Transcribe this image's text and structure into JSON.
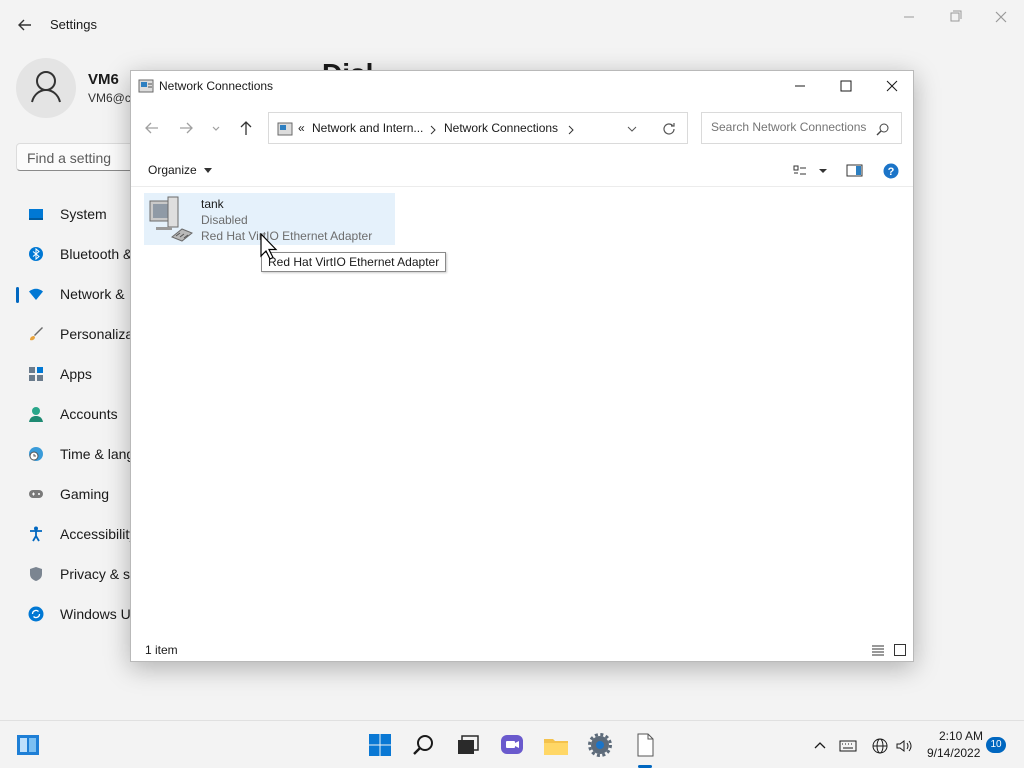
{
  "settings": {
    "title": "Settings",
    "user": {
      "name": "VM6",
      "email": "VM6@c"
    },
    "search_placeholder": "Find a setting",
    "page_heading_partial": "Disl",
    "nav": [
      {
        "label": "System",
        "icon": "monitor-icon"
      },
      {
        "label": "Bluetooth &",
        "icon": "bluetooth-icon"
      },
      {
        "label": "Network &",
        "icon": "wifi-icon",
        "selected": true
      },
      {
        "label": "Personaliza",
        "icon": "brush-icon"
      },
      {
        "label": "Apps",
        "icon": "apps-icon"
      },
      {
        "label": "Accounts",
        "icon": "person-icon"
      },
      {
        "label": "Time & lang",
        "icon": "clock-globe-icon"
      },
      {
        "label": "Gaming",
        "icon": "gamepad-icon"
      },
      {
        "label": "Accessibility",
        "icon": "accessibility-icon"
      },
      {
        "label": "Privacy & se",
        "icon": "shield-icon"
      },
      {
        "label": "Windows U",
        "icon": "sync-icon"
      }
    ]
  },
  "explorer": {
    "title": "Network Connections",
    "address": {
      "overflow": "«",
      "crumbs": [
        "Network and Intern...",
        "Network Connections"
      ]
    },
    "search_placeholder": "Search Network Connections",
    "toolbar": {
      "organize": "Organize"
    },
    "items": [
      {
        "name": "tank",
        "status": "Disabled",
        "device": "Red Hat VirtIO Ethernet Adapter"
      }
    ],
    "tooltip": "Red Hat VirtIO Ethernet Adapter",
    "statusbar": {
      "count": "1 item"
    }
  },
  "taskbar": {
    "time": "2:10 AM",
    "date": "9/14/2022",
    "notifications": "10"
  },
  "colors": {
    "accent": "#0067c0",
    "selection": "#e5f1fb"
  }
}
